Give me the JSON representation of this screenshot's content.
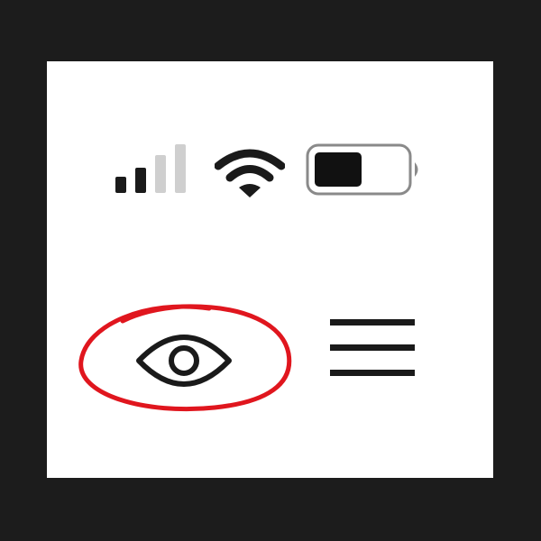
{
  "status_bar": {
    "signal_icon": "cellular-signal-icon",
    "signal_strength_bars": 2,
    "signal_total_bars": 4,
    "wifi_icon": "wifi-icon",
    "battery_icon": "battery-icon",
    "battery_level": 0.55
  },
  "toolbar": {
    "visibility_icon": "eye-icon",
    "highlighted": true,
    "highlight_color": "#e0161e",
    "menu_icon": "hamburger-menu-icon"
  },
  "colors": {
    "frame": "#1c1c1c",
    "screen": "#ffffff",
    "icon": "#1a1a1a",
    "inactive_bar": "#cfcfcf"
  }
}
